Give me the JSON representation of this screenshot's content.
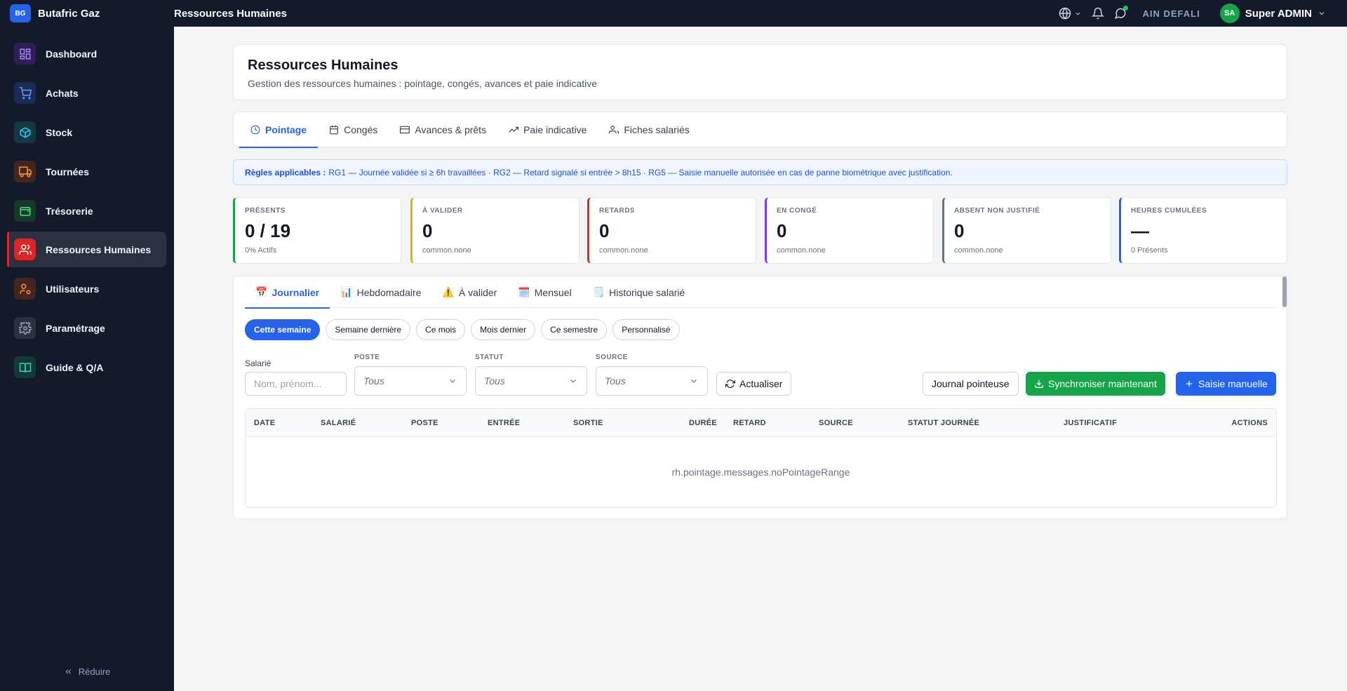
{
  "app": {
    "logo": "BG",
    "name": "Butafric Gaz"
  },
  "topbar": {
    "title": "Ressources Humaines",
    "site": "AIN DEFALI",
    "user": {
      "initials": "SA",
      "name": "Super ADMIN"
    }
  },
  "sidebar": {
    "items": [
      {
        "label": "Dashboard",
        "icon": "grid-icon",
        "color": "#8b5cf6"
      },
      {
        "label": "Achats",
        "icon": "cart-icon",
        "color": "#3b82f6"
      },
      {
        "label": "Stock",
        "icon": "box-icon",
        "color": "#06b6d4"
      },
      {
        "label": "Tournées",
        "icon": "truck-icon",
        "color": "#f97316"
      },
      {
        "label": "Trésorerie",
        "icon": "wallet-icon",
        "color": "#22c55e"
      },
      {
        "label": "Ressources Humaines",
        "icon": "users-icon",
        "color": "#ef4444"
      },
      {
        "label": "Utilisateurs",
        "icon": "user-cog-icon",
        "color": "#f97316"
      },
      {
        "label": "Paramétrage",
        "icon": "gear-icon",
        "color": "#9ca3af"
      },
      {
        "label": "Guide & Q/A",
        "icon": "book-icon",
        "color": "#14b8a6"
      }
    ],
    "collapse_label": "Réduire"
  },
  "header": {
    "title": "Ressources Humaines",
    "subtitle": "Gestion des ressources humaines : pointage, congés, avances et paie indicative"
  },
  "tabs": [
    {
      "label": "Pointage",
      "icon": "clock-icon"
    },
    {
      "label": "Congés",
      "icon": "calendar-icon"
    },
    {
      "label": "Avances & prêts",
      "icon": "card-icon"
    },
    {
      "label": "Paie indicative",
      "icon": "trend-icon"
    },
    {
      "label": "Fiches salariés",
      "icon": "users-icon"
    }
  ],
  "rules": {
    "prefix": "Règles applicables :",
    "text": "RG1 — Journée validée si ≥ 6h travaillées · RG2 — Retard signalé si entrée > 8h15 · RG5 — Saisie manuelle autorisée en cas de panne biométrique avec justification."
  },
  "kpis": [
    {
      "label": "PRÉSENTS",
      "value": "0 / 19",
      "sub": "0% Actifs",
      "color": "#16a34a"
    },
    {
      "label": "À VALIDER",
      "value": "0",
      "sub": "common.none",
      "color": "#eab308"
    },
    {
      "label": "RETARDS",
      "value": "0",
      "sub": "common.none",
      "color": "#dc2626"
    },
    {
      "label": "EN CONGÉ",
      "value": "0",
      "sub": "common.none",
      "color": "#7c3aed"
    },
    {
      "label": "ABSENT NON JUSTIFIÉ",
      "value": "0",
      "sub": "common.none",
      "color": "#64748b"
    },
    {
      "label": "HEURES CUMULÉES",
      "value": "—",
      "sub": "0 Présents",
      "color": "#2563eb"
    }
  ],
  "subtabs": [
    {
      "label": "Journalier",
      "emoji": "📅"
    },
    {
      "label": "Hebdomadaire",
      "emoji": "📊"
    },
    {
      "label": "À valider",
      "emoji": "⚠️"
    },
    {
      "label": "Mensuel",
      "emoji": "🗓️"
    },
    {
      "label": "Historique salarié",
      "emoji": "🗒️"
    }
  ],
  "periods": [
    "Cette semaine",
    "Semaine dernière",
    "Ce mois",
    "Mois dernier",
    "Ce semestre",
    "Personnalisé"
  ],
  "filters": {
    "employee_label": "Salarié",
    "employee_placeholder": "Nom, prénom...",
    "poste_label": "POSTE",
    "poste_value": "Tous",
    "statut_label": "STATUT",
    "statut_value": "Tous",
    "source_label": "SOURCE",
    "source_value": "Tous",
    "refresh": "Actualiser"
  },
  "actions": {
    "journal": "Journal pointeuse",
    "sync": "Synchroniser maintenant",
    "manual": "Saisie manuelle"
  },
  "table": {
    "columns": [
      "DATE",
      "SALARIÉ",
      "POSTE",
      "ENTRÉE",
      "SORTIE",
      "DURÉE",
      "RETARD",
      "SOURCE",
      "STATUT JOURNÉE",
      "JUSTIFICATIF",
      "ACTIONS"
    ],
    "empty": "rh.pointage.messages.noPointageRange"
  }
}
